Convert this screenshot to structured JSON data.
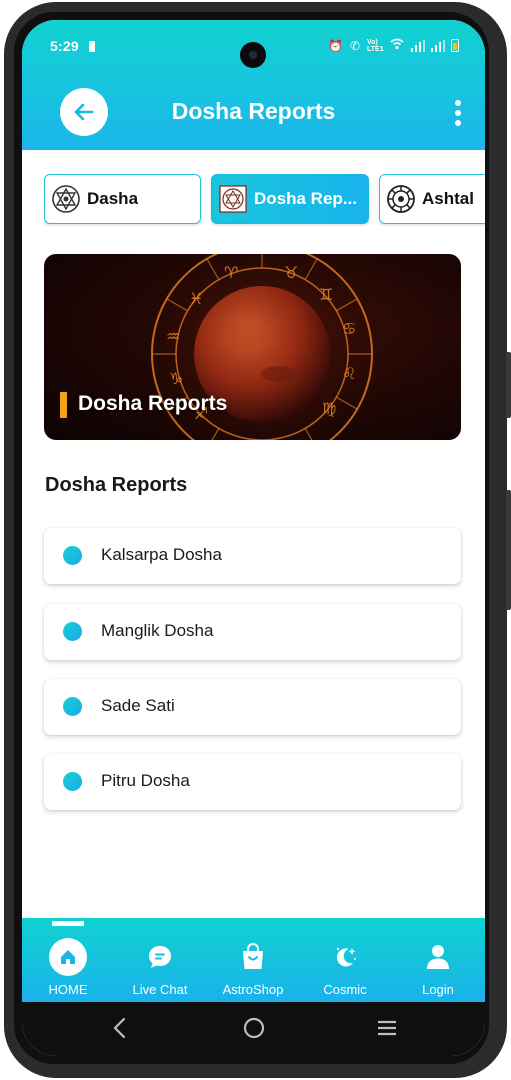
{
  "status_bar": {
    "time": "5:29",
    "network_label": "Vo) LTE1"
  },
  "header": {
    "title": "Dosha Reports"
  },
  "tabs": [
    {
      "label": "Dasha",
      "icon": "yantra-icon",
      "active": false
    },
    {
      "label": "Dosha Rep...",
      "icon": "yantra-icon",
      "active": true
    },
    {
      "label": "Ashtal",
      "icon": "zodiac-wheel-icon",
      "active": false
    }
  ],
  "banner": {
    "title": "Dosha Reports"
  },
  "section": {
    "title": "Dosha Reports"
  },
  "reports": [
    {
      "label": "Kalsarpa Dosha"
    },
    {
      "label": "Manglik Dosha"
    },
    {
      "label": "Sade Sati"
    },
    {
      "label": "Pitru Dosha"
    }
  ],
  "bottom_nav": [
    {
      "label": "HOME",
      "icon": "home-icon",
      "active": true
    },
    {
      "label": "Live Chat",
      "icon": "chat-icon",
      "active": false
    },
    {
      "label": "AstroShop",
      "icon": "shopping-bag-icon",
      "active": false
    },
    {
      "label": "Cosmic",
      "icon": "moon-star-icon",
      "active": false
    },
    {
      "label": "Login",
      "icon": "user-icon",
      "active": false
    }
  ],
  "colors": {
    "primary_teal": "#10d2cf",
    "primary_blue": "#1ab2ea",
    "banner_accent": "#f3a21a"
  }
}
